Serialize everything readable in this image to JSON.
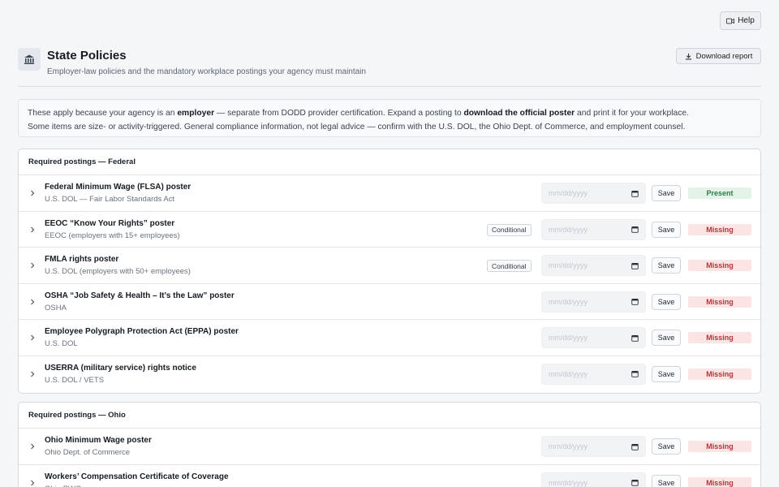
{
  "help": {
    "label": "Help"
  },
  "header": {
    "title": "State Policies",
    "subtitle": "Employer-law policies and the mandatory workplace postings your agency must maintain",
    "download_label": "Download report"
  },
  "info": {
    "line1_a": "These apply because your agency is an ",
    "line1_b": "employer",
    "line1_c": " — separate from DODD provider certification. Expand a posting to ",
    "line1_d": "download the official poster",
    "line1_e": " and print it for your workplace.",
    "line2": "Some items are size- or activity-triggered. General compliance information, not legal advice — confirm with the U.S. DOL, the Ohio Dept. of Commerce, and employment counsel."
  },
  "date_placeholder": "mm/dd/yyyy",
  "save_label": "Save",
  "conditional_label": "Conditional",
  "sections": [
    {
      "title": "Required postings — Federal",
      "rows": [
        {
          "title": "Federal Minimum Wage (FLSA) poster",
          "sub": "U.S. DOL — Fair Labor Standards Act",
          "conditional": false,
          "status": "Present"
        },
        {
          "title": "EEOC “Know Your Rights” poster",
          "sub": "EEOC (employers with 15+ employees)",
          "conditional": true,
          "status": "Missing"
        },
        {
          "title": "FMLA rights poster",
          "sub": "U.S. DOL (employers with 50+ employees)",
          "conditional": true,
          "status": "Missing"
        },
        {
          "title": "OSHA “Job Safety & Health – It’s the Law” poster",
          "sub": "OSHA",
          "conditional": false,
          "status": "Missing"
        },
        {
          "title": "Employee Polygraph Protection Act (EPPA) poster",
          "sub": "U.S. DOL",
          "conditional": false,
          "status": "Missing"
        },
        {
          "title": "USERRA (military service) rights notice",
          "sub": "U.S. DOL / VETS",
          "conditional": false,
          "status": "Missing"
        }
      ]
    },
    {
      "title": "Required postings — Ohio",
      "rows": [
        {
          "title": "Ohio Minimum Wage poster",
          "sub": "Ohio Dept. of Commerce",
          "conditional": false,
          "status": "Missing"
        },
        {
          "title": "Workers’ Compensation Certificate of Coverage",
          "sub": "Ohio BWC",
          "conditional": false,
          "status": "Missing"
        }
      ]
    }
  ]
}
